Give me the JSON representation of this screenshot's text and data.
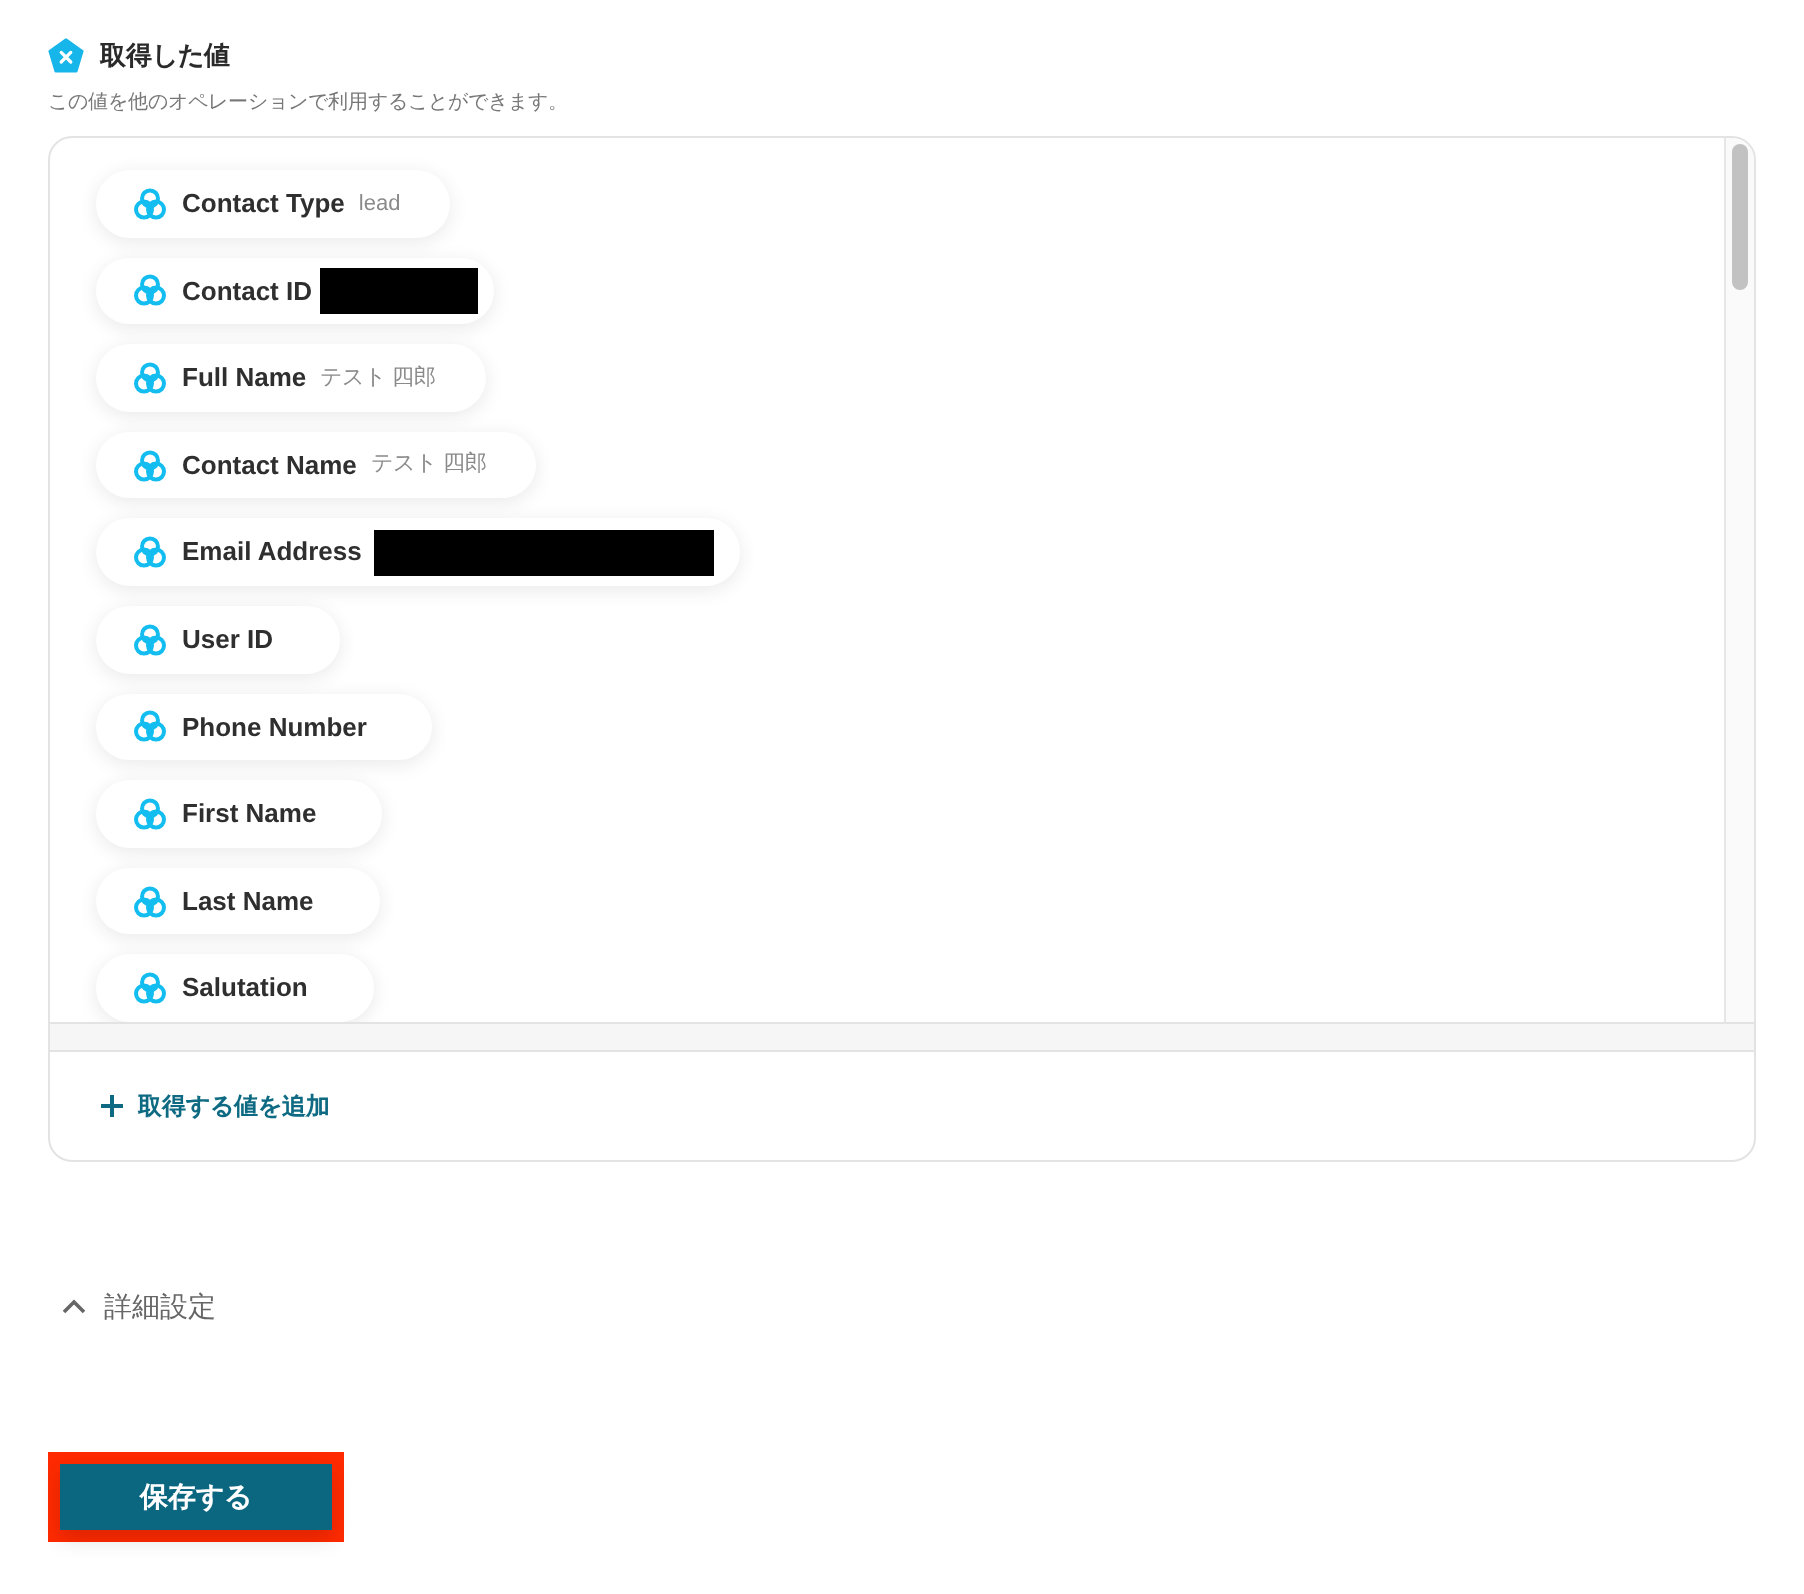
{
  "section": {
    "title": "取得した値",
    "description": "この値を他のオペレーションで利用することができます。"
  },
  "values": [
    {
      "label": "Contact Type",
      "kind": "text",
      "value": "lead"
    },
    {
      "label": "Contact ID",
      "kind": "shortmask"
    },
    {
      "label": "Full Name",
      "kind": "text",
      "value": "テスト 四郎"
    },
    {
      "label": "Contact Name",
      "kind": "text",
      "value": "テスト 四郎"
    },
    {
      "label": "Email Address",
      "kind": "longmask"
    },
    {
      "label": "User ID",
      "kind": "name"
    },
    {
      "label": "Phone Number",
      "kind": "name"
    },
    {
      "label": "First Name",
      "kind": "name"
    },
    {
      "label": "Last Name",
      "kind": "name"
    },
    {
      "label": "Salutation",
      "kind": "name"
    }
  ],
  "add_link": {
    "label": "取得する値を追加"
  },
  "advanced": {
    "label": "詳細設定"
  },
  "save_button": {
    "label": "保存する",
    "highlighted": true
  }
}
